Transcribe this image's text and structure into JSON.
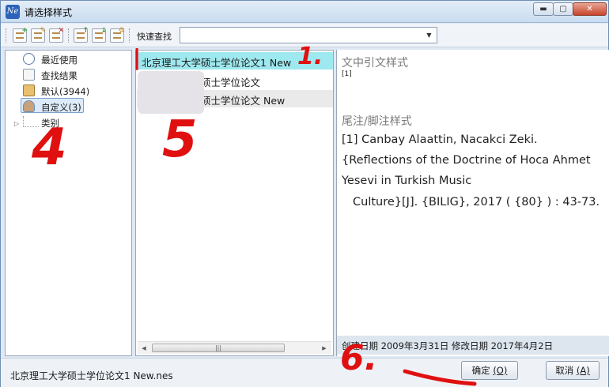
{
  "window": {
    "title": "请选择样式",
    "app_icon": "Ne",
    "controls": {
      "minimize": "▬",
      "maximize": "▢",
      "close": "✕"
    }
  },
  "toolbar": {
    "icons": [
      "new-style-icon",
      "edit-style-icon",
      "delete-style-icon",
      "import-style-icon",
      "export-style-icon",
      "settings-style-icon"
    ],
    "search_label": "快速查找",
    "search_value": ""
  },
  "tree": {
    "items": [
      {
        "label": "最近使用",
        "icon": "clock-icon"
      },
      {
        "label": "查找结果",
        "icon": "search-result-icon"
      },
      {
        "label": "默认(3944)",
        "icon": "book-icon"
      },
      {
        "label": "自定义(3)",
        "icon": "user-icon"
      },
      {
        "label": "类别",
        "icon": "category-icon"
      }
    ],
    "selected_index": 3
  },
  "styles": {
    "rows": [
      "北京理工大学硕士学位论文1 New",
      "北京理工大学硕士学位论文",
      "北京理工大学硕士学位论文 New"
    ],
    "selected_index": 0
  },
  "preview": {
    "cite_title": "文中引文样式",
    "cite_sample": "[1]",
    "foot_title": "尾注/脚注样式",
    "foot_lines": [
      "[1] Canbay Alaattin, Nacakci Zeki.",
      "{Reflections of the Doctrine of Hoca Ahmet",
      "Yesevi in Turkish Music",
      "Culture}[J]. {BILIG}, 2017 ( {80} ) : 43-73."
    ],
    "info": "创建日期  2009年3月31日   修改日期  2017年4月2日"
  },
  "footer": {
    "file_name": "北京理工大学硕士学位论文1 New.nes",
    "ok_label": "确定",
    "ok_key": "(O)",
    "cancel_label": "取消",
    "cancel_key": "(A)"
  },
  "annotations": [
    "1.",
    "4",
    "5",
    "6."
  ],
  "colors": {
    "selected_row": "#9ee8ef",
    "annotation": "#e01010"
  }
}
